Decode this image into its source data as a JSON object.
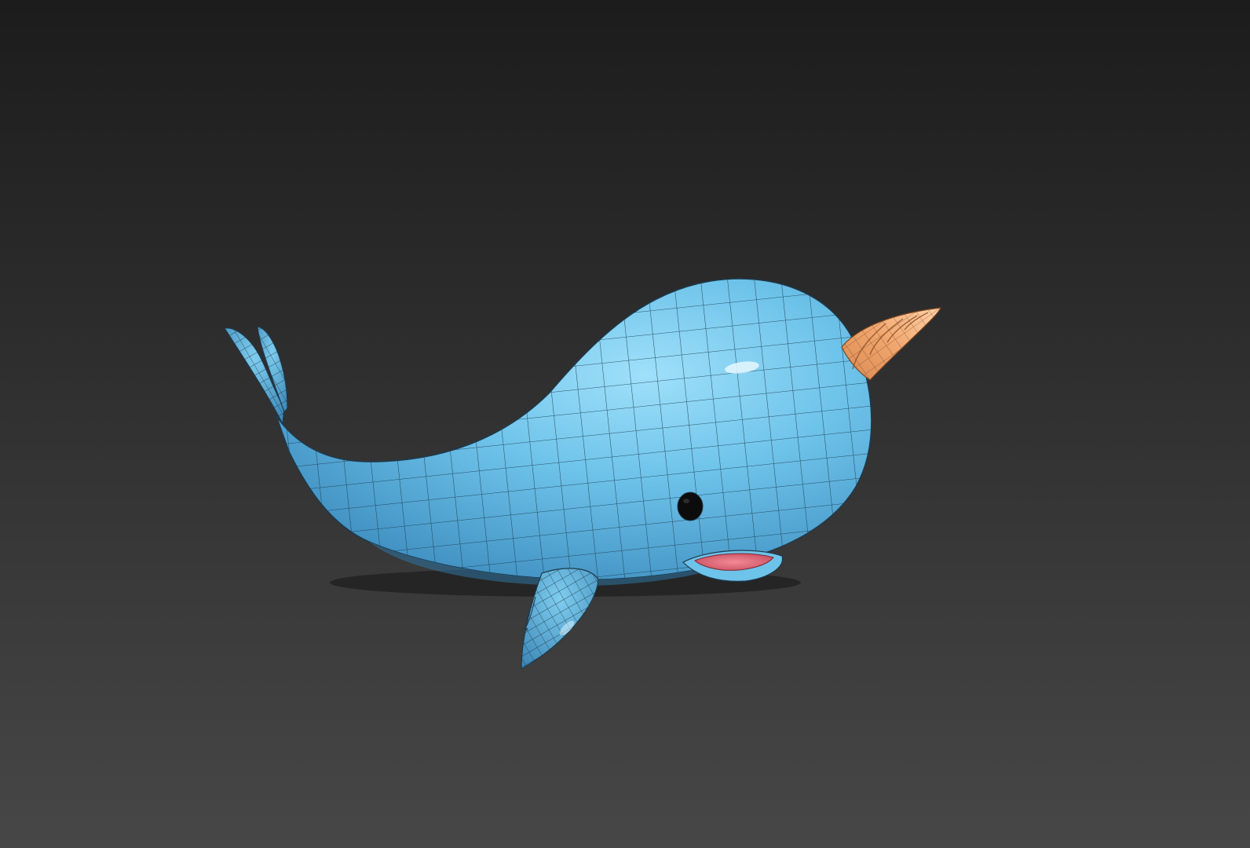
{
  "viewport": {
    "background_top": "#1c1c1c",
    "background_bottom": "#474747"
  },
  "model": {
    "subject": "narwhal-wireframe-model",
    "body_color": "#6ec3ea",
    "body_highlight": "#a6e4fb",
    "body_shadow": "#3f8fc0",
    "wire_color": "#1d3a4c",
    "horn_color": "#f0a66e",
    "horn_highlight": "#ffd3a8",
    "mouth_color": "#e8707e",
    "eye_color": "#0c0c0c"
  }
}
